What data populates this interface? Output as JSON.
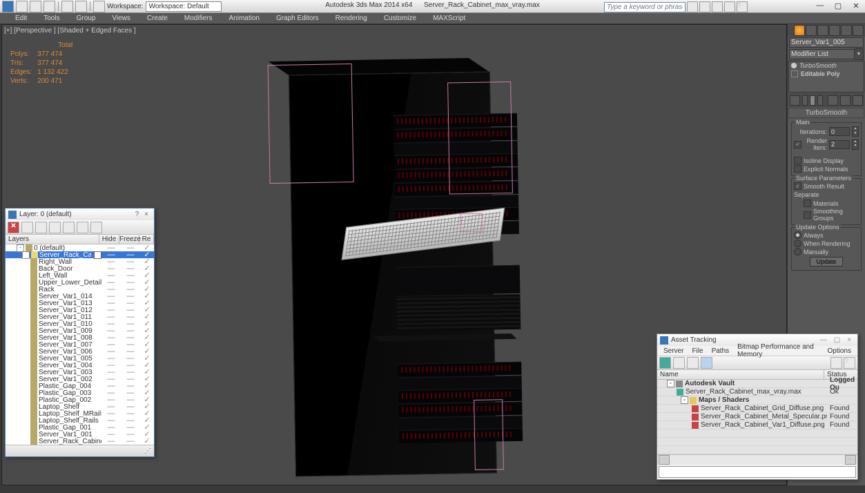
{
  "app": {
    "title_left": "Autodesk 3ds Max 2014 x64",
    "title_right": "Server_Rack_Cabinet_max_vray.max"
  },
  "workspace": {
    "label": "Workspace: Default"
  },
  "search": {
    "placeholder": "Type a keyword or phrase"
  },
  "menu": [
    "Edit",
    "Tools",
    "Group",
    "Views",
    "Create",
    "Modifiers",
    "Animation",
    "Graph Editors",
    "Rendering",
    "Customize",
    "MAXScript"
  ],
  "viewport": {
    "label": "[+] [Perspective ] [Shaded + Edged Faces ]"
  },
  "stats": {
    "hdr": "Total",
    "rows": [
      [
        "Polys:",
        "377 474"
      ],
      [
        "Tris:",
        "377 474"
      ],
      [
        "Edges:",
        "1 132 422"
      ],
      [
        "Verts:",
        "200 471"
      ]
    ]
  },
  "rp": {
    "obj_name": "Server_Var1_005",
    "mod_list": "Modifier List",
    "stack": [
      {
        "t": "TurboSmooth",
        "i": true
      },
      {
        "t": "Editable Poly",
        "i": false
      }
    ],
    "rollout_title": "TurboSmooth",
    "main": "Main",
    "iter_l": "Iterations:",
    "iter_v": "0",
    "rend_l": "Render Iters:",
    "rend_v": "2",
    "iso": "Isoline Display",
    "exn": "Explicit Normals",
    "surf": "Surface Parameters",
    "smr": "Smooth Result",
    "sep": "Separate",
    "mat": "Materials",
    "smg": "Smoothing Groups",
    "upd": "Update Options",
    "always": "Always",
    "when": "When Rendering",
    "man": "Manually",
    "upd_btn": "Update"
  },
  "layers": {
    "title": "Layer: 0 (default)",
    "cols": {
      "layers": "Layers",
      "hide": "Hide",
      "freeze": "Freeze",
      "render": "Re"
    },
    "rows": [
      {
        "ind": 16,
        "exp": "-",
        "ico": "f",
        "nm": "0 (default)"
      },
      {
        "ind": 24,
        "exp": "-",
        "ico": "o",
        "nm": "Server_Rack_Cabinet",
        "sel": true,
        "cb": true
      },
      {
        "ind": 36,
        "ico": "o",
        "nm": "Right_Wall"
      },
      {
        "ind": 36,
        "ico": "o",
        "nm": "Back_Door"
      },
      {
        "ind": 36,
        "ico": "o",
        "nm": "Left_Wall"
      },
      {
        "ind": 36,
        "ico": "o",
        "nm": "Upper_Lower_Details"
      },
      {
        "ind": 36,
        "ico": "o",
        "nm": "Rack"
      },
      {
        "ind": 36,
        "ico": "o",
        "nm": "Server_Var1_014"
      },
      {
        "ind": 36,
        "ico": "o",
        "nm": "Server_Var1_013"
      },
      {
        "ind": 36,
        "ico": "o",
        "nm": "Server_Var1_012"
      },
      {
        "ind": 36,
        "ico": "o",
        "nm": "Server_Var1_011"
      },
      {
        "ind": 36,
        "ico": "o",
        "nm": "Server_Var1_010"
      },
      {
        "ind": 36,
        "ico": "o",
        "nm": "Server_Var1_009"
      },
      {
        "ind": 36,
        "ico": "o",
        "nm": "Server_Var1_008"
      },
      {
        "ind": 36,
        "ico": "o",
        "nm": "Server_Var1_007"
      },
      {
        "ind": 36,
        "ico": "o",
        "nm": "Server_Var1_006"
      },
      {
        "ind": 36,
        "ico": "o",
        "nm": "Server_Var1_005"
      },
      {
        "ind": 36,
        "ico": "o",
        "nm": "Server_Var1_004"
      },
      {
        "ind": 36,
        "ico": "o",
        "nm": "Server_Var1_003"
      },
      {
        "ind": 36,
        "ico": "o",
        "nm": "Server_Var1_002"
      },
      {
        "ind": 36,
        "ico": "o",
        "nm": "Plastic_Gap_004"
      },
      {
        "ind": 36,
        "ico": "o",
        "nm": "Plastic_Gap_003"
      },
      {
        "ind": 36,
        "ico": "o",
        "nm": "Plastic_Gap_002"
      },
      {
        "ind": 36,
        "ico": "o",
        "nm": "Laptop_Shelf"
      },
      {
        "ind": 36,
        "ico": "o",
        "nm": "Laptop_Shelf_MRails"
      },
      {
        "ind": 36,
        "ico": "o",
        "nm": "Laptop_Shelf_Rails"
      },
      {
        "ind": 36,
        "ico": "o",
        "nm": "Plastic_Gap_001"
      },
      {
        "ind": 36,
        "ico": "o",
        "nm": "Server_Var1_001"
      },
      {
        "ind": 36,
        "ico": "o",
        "nm": "Server_Rack_Cabinet"
      }
    ]
  },
  "assets": {
    "title": "Asset Tracking",
    "menu": [
      "Server",
      "File",
      "Paths",
      "Bitmap Performance and Memory",
      "Options"
    ],
    "cols": {
      "name": "Name",
      "status": "Status"
    },
    "rows": [
      {
        "ind": 14,
        "exp": "-",
        "cls": "vault",
        "nm": "Autodesk Vault",
        "st": "Logged Ou",
        "b": true
      },
      {
        "ind": 28,
        "cls": "max",
        "nm": "Server_Rack_Cabinet_max_vray.max",
        "st": "Ok"
      },
      {
        "ind": 34,
        "exp": "-",
        "cls": "fold",
        "nm": "Maps / Shaders",
        "b": true
      },
      {
        "ind": 50,
        "cls": "img",
        "nm": "Server_Rack_Cabinet_Grid_Diffuse.png",
        "st": "Found"
      },
      {
        "ind": 50,
        "cls": "img",
        "nm": "Server_Rack_Cabinet_Metal_Specular.png",
        "st": "Found"
      },
      {
        "ind": 50,
        "cls": "img",
        "nm": "Server_Rack_Cabinet_Var1_Diffuse.png",
        "st": "Found"
      }
    ]
  }
}
